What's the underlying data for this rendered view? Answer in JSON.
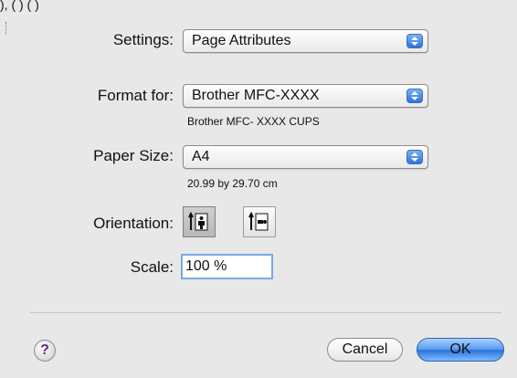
{
  "top_fragment": "),                           (              )                    (         )",
  "settings": {
    "label": "Settings:",
    "value": "Page Attributes"
  },
  "format_for": {
    "label": "Format for:",
    "value": "Brother MFC-XXXX",
    "detail": "Brother MFC- XXXX CUPS"
  },
  "paper_size": {
    "label": "Paper Size:",
    "value": "A4",
    "detail": "20.99 by 29.70 cm"
  },
  "orientation": {
    "label": "Orientation:",
    "options": [
      "portrait",
      "landscape"
    ],
    "selected": "portrait"
  },
  "scale": {
    "label": "Scale:",
    "value": "100 %"
  },
  "buttons": {
    "help": "?",
    "cancel": "Cancel",
    "ok": "OK"
  },
  "colors": {
    "accent": "#2b72da",
    "focus": "#7aa8e3"
  }
}
